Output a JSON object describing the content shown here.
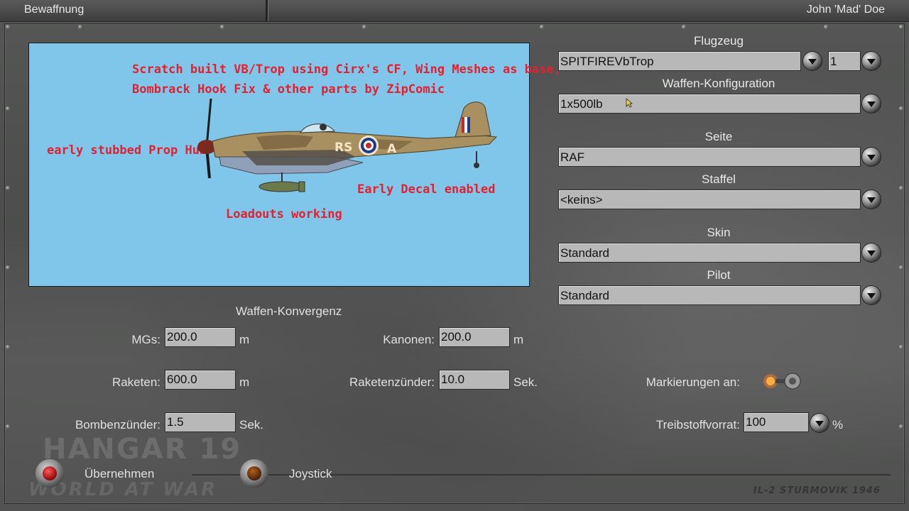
{
  "window": {
    "title": "Bewaffnung",
    "user": "John 'Mad' Doe"
  },
  "preview": {
    "annotations": {
      "line1": "Scratch built VB/Trop using Cirx's CF, Wing Meshes as base,",
      "line2": "Bombrack Hook Fix & other parts by ZipComic",
      "prop_hub": "early stubbed Prop Hub",
      "decal": "Early Decal enabled",
      "loadouts": "Loadouts working"
    },
    "aircraft_code_left": "RS",
    "aircraft_code_right": "A",
    "colors": {
      "background": "#80c6ea",
      "annotation": "#e4202e"
    }
  },
  "config": {
    "aircraft": {
      "label": "Flugzeug",
      "value": "SPITFIREVbTrop",
      "count": "1"
    },
    "weapons": {
      "label": "Waffen-Konfiguration",
      "value": "1x500lb"
    },
    "side": {
      "label": "Seite",
      "value": "RAF"
    },
    "squadron": {
      "label": "Staffel",
      "value": "<keins>"
    },
    "skin": {
      "label": "Skin",
      "value": "Standard"
    },
    "pilot": {
      "label": "Pilot",
      "value": "Standard"
    }
  },
  "convergence": {
    "heading": "Waffen-Konvergenz",
    "mgs": {
      "label": "MGs:",
      "value": "200.0",
      "unit": "m"
    },
    "cannons": {
      "label": "Kanonen:",
      "value": "200.0",
      "unit": "m"
    },
    "rockets": {
      "label": "Raketen:",
      "value": "600.0",
      "unit": "m"
    },
    "rocket_fuse": {
      "label": "Raketenzünder:",
      "value": "10.0",
      "unit": "Sek."
    },
    "bomb_fuse": {
      "label": "Bombenzünder:",
      "value": "1.5",
      "unit": "Sek."
    },
    "markings": {
      "label": "Markierungen an:"
    },
    "fuel": {
      "label": "Treibstoffvorrat:",
      "value": "100",
      "unit": "%"
    }
  },
  "actions": {
    "apply": "Übernehmen",
    "joystick": "Joystick"
  },
  "branding": {
    "logo": "HANGAR 19",
    "logo_sub": "WORLD AT WAR",
    "game": "IL-2 STURMOVIK 1946"
  }
}
